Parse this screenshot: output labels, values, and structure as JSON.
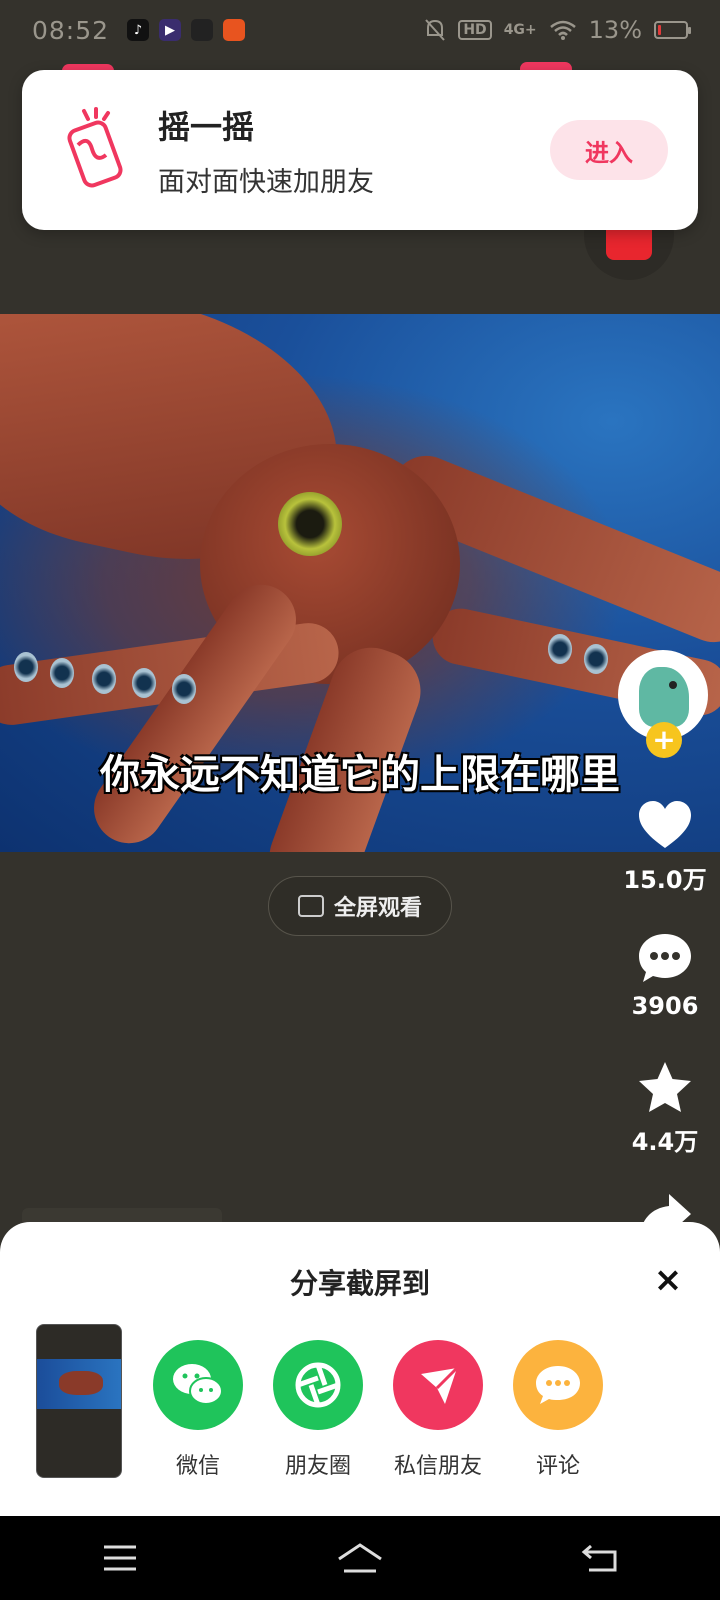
{
  "status_bar": {
    "time": "08:52",
    "app_icons": [
      "tiktok-icon",
      "player-icon",
      "book-icon",
      "shop-icon"
    ],
    "network": "4G+",
    "hd_label": "HD",
    "battery": "13%",
    "battery_level": 0.13,
    "battery_color": "#e03a3a"
  },
  "banner": {
    "title": "摇一摇",
    "subtitle": "面对面快速加朋友",
    "button_label": "进入",
    "accent": "#f0375f"
  },
  "video": {
    "subtitle": "你永远不知道它的上限在哪里",
    "fullscreen_label": "全屏观看"
  },
  "actions": {
    "like_count": "15.0万",
    "comment_count": "3906",
    "favorite_count": "4.4万",
    "follow_symbol": "+"
  },
  "share_sheet": {
    "title": "分享截屏到",
    "close_symbol": "×",
    "options": [
      {
        "label": "微信",
        "icon": "wechat-icon",
        "color": "#1fc45b"
      },
      {
        "label": "朋友圈",
        "icon": "moments-icon",
        "color": "#1fc45b"
      },
      {
        "label": "私信朋友",
        "icon": "send-icon",
        "color": "#f0375f"
      },
      {
        "label": "评论",
        "icon": "comment-icon",
        "color": "#fcb33e"
      }
    ]
  },
  "nav_bar": {
    "buttons": [
      "menu-icon",
      "home-icon",
      "back-icon"
    ]
  }
}
